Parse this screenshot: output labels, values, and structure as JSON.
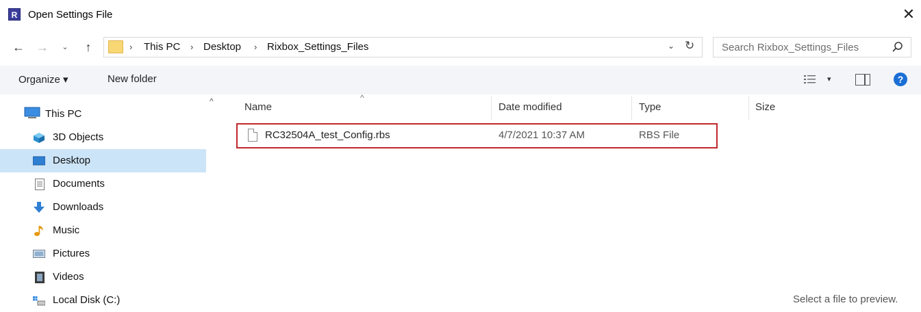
{
  "window": {
    "title": "Open Settings File",
    "app_icon_letter": "R",
    "close_glyph": "✕"
  },
  "nav": {
    "back_glyph": "←",
    "forward_glyph": "→",
    "recent_glyph": "⌄",
    "up_glyph": "↑",
    "refresh_glyph": "↻",
    "dropdown_glyph": "⌄",
    "breadcrumb": [
      {
        "label": "This PC"
      },
      {
        "label": "Desktop"
      },
      {
        "label": "Rixbox_Settings_Files"
      }
    ],
    "separator": "›"
  },
  "search": {
    "placeholder": "Search Rixbox_Settings_Files"
  },
  "toolbar": {
    "organize_label": "Organize ▾",
    "new_folder_label": "New folder",
    "view_dropdown": "▾",
    "help_glyph": "?"
  },
  "sidebar": {
    "scroll_up_glyph": "^",
    "items": [
      {
        "label": "This PC",
        "icon": "computer-icon",
        "selected": false
      },
      {
        "label": "3D Objects",
        "icon": "cube-icon",
        "selected": false
      },
      {
        "label": "Desktop",
        "icon": "desktop-icon",
        "selected": true
      },
      {
        "label": "Documents",
        "icon": "document-icon",
        "selected": false
      },
      {
        "label": "Downloads",
        "icon": "download-arrow-icon",
        "selected": false
      },
      {
        "label": "Music",
        "icon": "music-note-icon",
        "selected": false
      },
      {
        "label": "Pictures",
        "icon": "pictures-icon",
        "selected": false
      },
      {
        "label": "Videos",
        "icon": "film-icon",
        "selected": false
      },
      {
        "label": "Local Disk (C:)",
        "icon": "drive-icon",
        "selected": false
      }
    ]
  },
  "file_list": {
    "sort_glyph": "^",
    "columns": [
      "Name",
      "Date modified",
      "Type",
      "Size"
    ],
    "rows": [
      {
        "name": "RC32504A_test_Config.rbs",
        "date": "4/7/2021 10:37 AM",
        "type": "RBS File",
        "size": ""
      }
    ]
  },
  "preview": {
    "text": "Select a file to preview."
  },
  "colors": {
    "selection": "#cce4f7",
    "highlight_border": "#c1272d",
    "accent": "#1a6fd4"
  }
}
